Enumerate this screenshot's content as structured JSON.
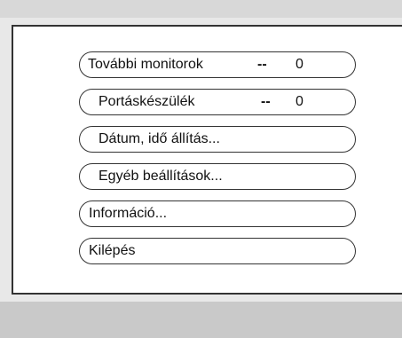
{
  "menu": {
    "items": [
      {
        "label": "További monitorok",
        "separator": "--",
        "value": "0"
      },
      {
        "label": "Portáskészülék",
        "separator": "--",
        "value": "0"
      },
      {
        "label": "Dátum, idő állítás..."
      },
      {
        "label": "Egyéb beállítások..."
      },
      {
        "label": "Információ..."
      },
      {
        "label": "Kilépés"
      }
    ]
  }
}
